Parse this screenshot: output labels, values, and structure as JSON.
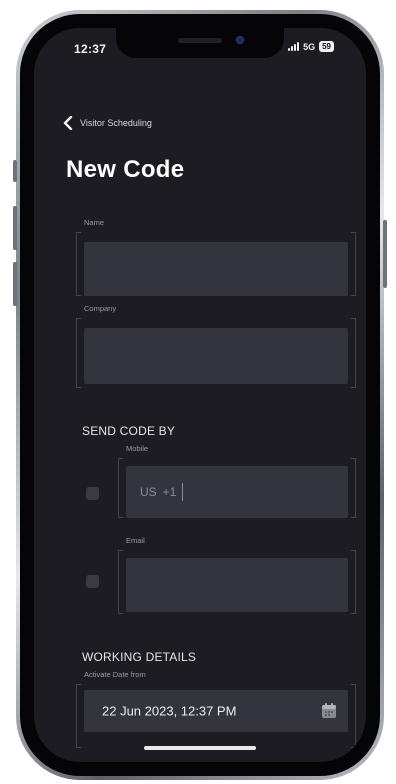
{
  "status_bar": {
    "time": "12:37",
    "network": "5G",
    "battery": "59"
  },
  "nav": {
    "back_label": "Visitor Scheduling"
  },
  "page": {
    "title": "New Code"
  },
  "form": {
    "name_label": "Name",
    "name_value": "",
    "company_label": "Company",
    "company_value": "",
    "send_code_section": "SEND CODE BY",
    "mobile_label": "Mobile",
    "mobile_country": "US",
    "mobile_dial_code": "+1",
    "mobile_value": "",
    "email_label": "Email",
    "email_value": "",
    "working_details_section": "WORKING DETAILS",
    "activate_label": "Activate Date from",
    "activate_value": "22 Jun 2023, 12:37 PM"
  },
  "colors": {
    "screen_bg": "#1c1c22",
    "input_bg": "#34343d",
    "text": "#e8e8ec"
  }
}
